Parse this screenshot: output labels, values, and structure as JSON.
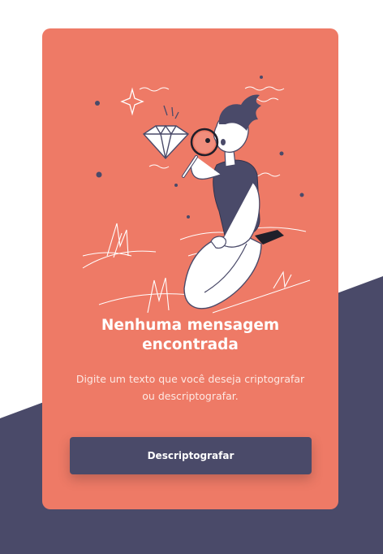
{
  "colors": {
    "card": "#ee7a66",
    "background_shape": "#4a4a69",
    "button": "#4a4a69",
    "text": "#ffffff"
  },
  "empty_state": {
    "illustration": "person-inspecting-diamond-with-magnifier",
    "title": "Nenhuma mensagem encontrada",
    "description": "Digite um texto que você deseja criptografar ou descriptografar."
  },
  "actions": {
    "decrypt_label": "Descriptografar"
  }
}
